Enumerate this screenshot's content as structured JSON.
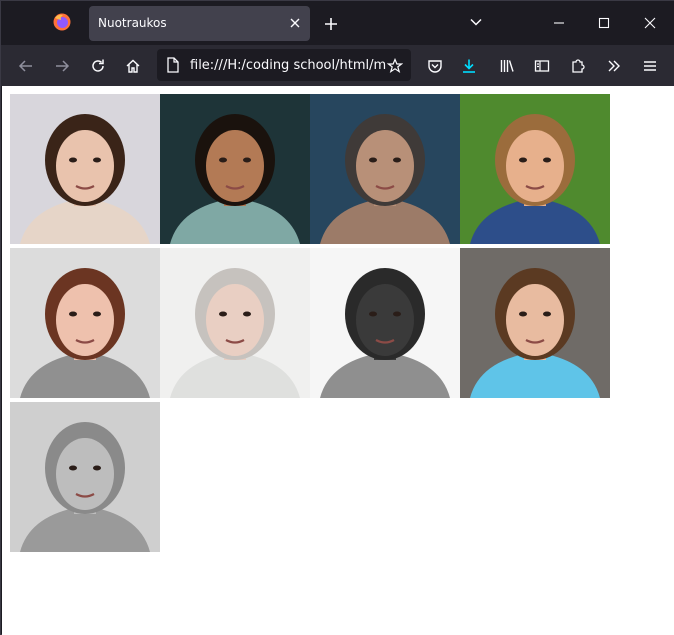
{
  "browser": {
    "tab_title": "Nuotraukos",
    "url": "file:///H:/coding school/html/m",
    "accent": "#00ddff"
  },
  "icons": {
    "firefox": "firefox-logo-icon",
    "close": "close-icon",
    "new_tab": "plus-icon",
    "tab_list": "chevron-down-icon",
    "back": "arrow-left-icon",
    "forward": "arrow-right-icon",
    "reload": "reload-icon",
    "home": "home-icon",
    "page": "document-icon",
    "bookmark": "star-icon",
    "pocket": "pocket-icon",
    "downloads": "download-icon",
    "library": "library-icon",
    "sidebar": "sidebar-icon",
    "extensions": "puzzle-icon",
    "overflow": "double-chevron-icon",
    "menu": "hamburger-icon"
  },
  "gallery": {
    "photos": [
      {
        "name": "photo-1",
        "bg": "#d8d6dc",
        "hair": "#3a2418",
        "skin": "#e9c3ad",
        "shirt": "#e6d5c8"
      },
      {
        "name": "photo-2",
        "bg": "#1e3438",
        "hair": "#1a120d",
        "skin": "#b37a55",
        "shirt": "#7fa8a4"
      },
      {
        "name": "photo-3",
        "bg": "#27465e",
        "hair": "#3f3a38",
        "skin": "#b89078",
        "shirt": "#9c7b68"
      },
      {
        "name": "photo-4",
        "bg": "#4f8a2e",
        "hair": "#9b6c3c",
        "skin": "#e7b08c",
        "shirt": "#2d4e8a"
      },
      {
        "name": "photo-5",
        "bg": "#dcdcdc",
        "hair": "#6b3522",
        "skin": "#eec1ad",
        "shirt": "#909090"
      },
      {
        "name": "photo-6",
        "bg": "#f0f0ef",
        "hair": "#c6c2be",
        "skin": "#e9cfc3",
        "shirt": "#dfe0de"
      },
      {
        "name": "photo-7",
        "bg": "#f6f6f6",
        "hair": "#2a2a2a",
        "skin": "#3a3a3a",
        "shirt": "#8f8f8f"
      },
      {
        "name": "photo-8",
        "bg": "#6f6b67",
        "hair": "#5b3a22",
        "skin": "#e8bba0",
        "shirt": "#5fc4e8"
      },
      {
        "name": "photo-9",
        "bg": "#cfcfcf",
        "hair": "#8a8a8a",
        "skin": "#bdbdbd",
        "shirt": "#9a9a9a"
      }
    ]
  }
}
